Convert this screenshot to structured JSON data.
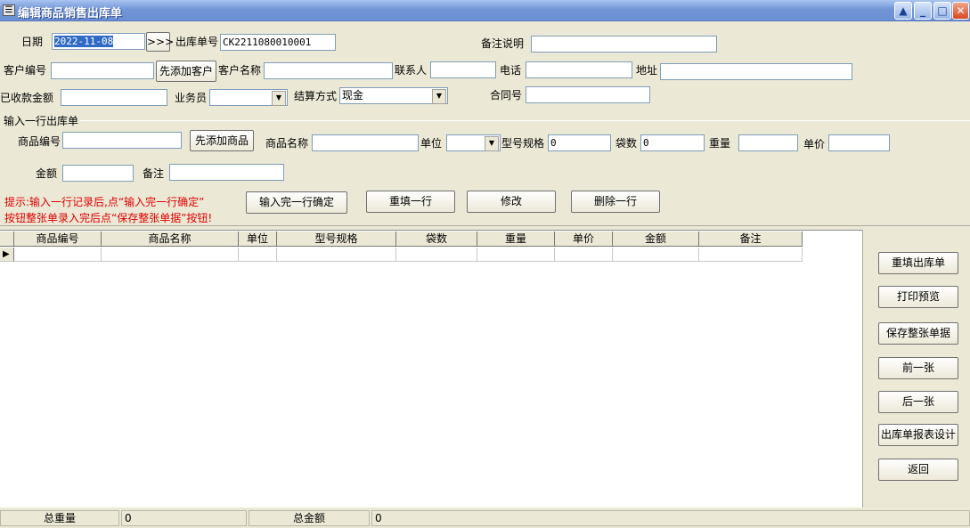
{
  "window": {
    "title": "编辑商品销售出库单",
    "icon_glyph": "☰"
  },
  "header": {
    "date_label": "日期",
    "date_value": "2022-11-08",
    "date_button": ">>>",
    "order_no_label": "出库单号",
    "order_no_value": "CK2211080010001",
    "remark_label": "备注说明",
    "remark_value": "",
    "customer_no_label": "客户编号",
    "customer_no_value": "",
    "add_customer_button": "先添加客户",
    "customer_name_label": "客户名称",
    "customer_name_value": "",
    "contact_label": "联系人",
    "contact_value": "",
    "phone_label": "电话",
    "phone_value": "",
    "address_label": "地址",
    "address_value": "",
    "received_label": "已收款金额",
    "received_value": "",
    "salesman_label": "业务员",
    "salesman_value": "",
    "settle_label": "结算方式",
    "settle_value": "现金",
    "contract_label": "合同号",
    "contract_value": ""
  },
  "line_entry": {
    "group_label": "输入一行出库单",
    "product_no_label": "商品编号",
    "product_no_value": "",
    "add_product_button": "先添加商品",
    "product_name_label": "商品名称",
    "product_name_value": "",
    "unit_label": "单位",
    "unit_value": "",
    "spec_label": "型号规格",
    "spec_value": "0",
    "bags_label": "袋数",
    "bags_value": "0",
    "weight_label": "重量",
    "weight_value": "",
    "price_label": "单价",
    "price_value": "",
    "amount_label": "金额",
    "amount_value": "",
    "note_label": "备注",
    "note_value": "",
    "hint_line1": "提示:输入一行记录后,点“输入完一行确定”",
    "hint_line2": "按钮整张单录入完后点“保存整张单据”按钮!",
    "confirm_button": "输入完一行确定",
    "refill_button": "重填一行",
    "edit_button": "修改",
    "delete_button": "删除一行"
  },
  "grid": {
    "columns": [
      "商品编号",
      "商品名称",
      "单位",
      "型号规格",
      "袋数",
      "重量",
      "单价",
      "金额",
      "备注"
    ],
    "row_indicator": "▶",
    "rows": []
  },
  "side_buttons": {
    "refill_order": "重填出库单",
    "print_preview": "打印预览",
    "save_order": "保存整张单据",
    "prev": "前一张",
    "next": "后一张",
    "report_design": "出库单报表设计",
    "back": "返回"
  },
  "status": {
    "total_weight_label": "总重量",
    "total_weight_value": "0",
    "total_amount_label": "总金额",
    "total_amount_value": "0"
  }
}
